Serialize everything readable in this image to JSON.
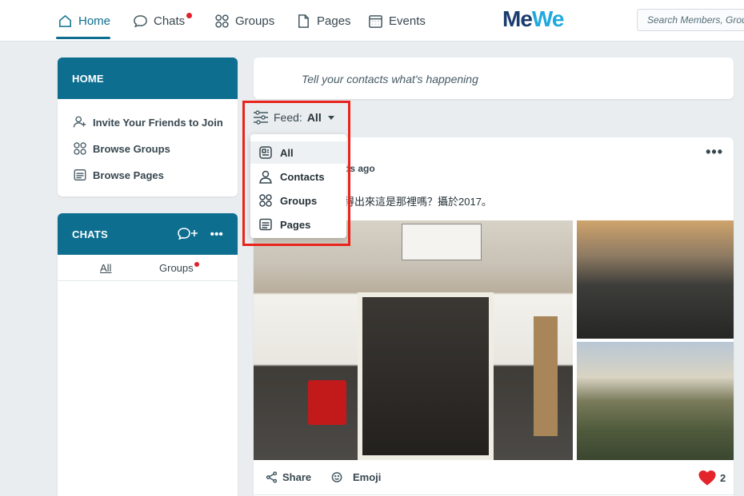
{
  "nav": {
    "items": [
      {
        "label": "Home",
        "icon": "home-icon",
        "active": true
      },
      {
        "label": "Chats",
        "icon": "chat-bubble-icon",
        "badge": true
      },
      {
        "label": "Groups",
        "icon": "groups-icon"
      },
      {
        "label": "Pages",
        "icon": "page-icon"
      },
      {
        "label": "Events",
        "icon": "calendar-icon"
      }
    ],
    "logo": {
      "m": "M",
      "e1": "e",
      "w": "W",
      "e2": "e"
    },
    "search_placeholder": "Search Members, Groups"
  },
  "home_card": {
    "title": "HOME",
    "links": [
      {
        "label": "Invite Your Friends to Join",
        "icon": "add-person-icon"
      },
      {
        "label": "Browse Groups",
        "icon": "groups-icon"
      },
      {
        "label": "Browse Pages",
        "icon": "page-icon"
      }
    ]
  },
  "chats_card": {
    "title": "CHATS",
    "new_chat_icon": "new-chat-icon",
    "more_label": "•••",
    "tabs": [
      {
        "label": "All"
      },
      {
        "label": "Groups",
        "badge": true
      }
    ]
  },
  "compose": {
    "placeholder": "Tell your contacts what's happening"
  },
  "feed_filter": {
    "label": "Feed:",
    "value": "All",
    "options": [
      {
        "label": "All",
        "icon": "feed-icon",
        "selected": true
      },
      {
        "label": "Contacts",
        "icon": "person-icon"
      },
      {
        "label": "Groups",
        "icon": "groups-icon"
      },
      {
        "label": "Pages",
        "icon": "page-icon"
      }
    ]
  },
  "post": {
    "more_label": "•••",
    "time_fragment": "ds ago",
    "text_fragment": "得出來這是那裡嗎？攝於2017。",
    "actions": {
      "share": "Share",
      "emoji": "Emoji"
    },
    "likes": "2"
  },
  "colors": {
    "brand": "#0d6e90",
    "highlight": "#e8241c",
    "badge": "#e0202c",
    "heart": "#e3242b"
  }
}
